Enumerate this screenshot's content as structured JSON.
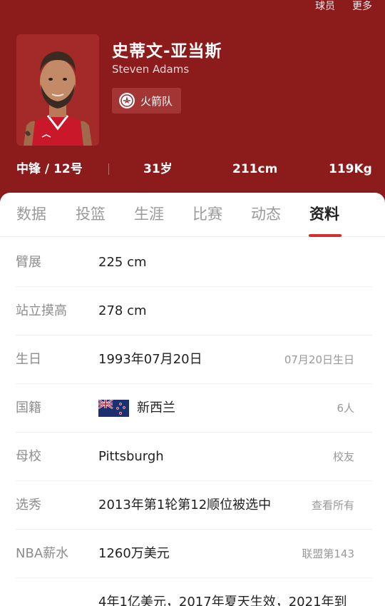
{
  "header": {
    "actions": [
      "球员",
      "更多"
    ],
    "background_color": "#8c1c1c"
  },
  "player": {
    "name_cn": "史蒂文-亚当斯",
    "name_en": "Steven Adams",
    "team": "火箭队",
    "position_number": "中锋 / 12号",
    "age": "31岁",
    "height": "211cm",
    "weight": "119Kg"
  },
  "tabs": {
    "items": [
      "数据",
      "投篮",
      "生涯",
      "比赛",
      "动态",
      "资料"
    ],
    "active": "资料",
    "accent_color": "#d0312d"
  },
  "profile": {
    "rows": [
      {
        "label": "臂展",
        "value": "225 cm",
        "extra": ""
      },
      {
        "label": "站立摸高",
        "value": "278 cm",
        "extra": ""
      },
      {
        "label": "生日",
        "value": "1993年07月20日",
        "extra": "07月20日生日"
      },
      {
        "label": "国籍",
        "value": "新西兰",
        "extra": "6人",
        "icon": "new-zealand-flag-icon"
      },
      {
        "label": "母校",
        "value": "Pittsburgh",
        "extra": "校友"
      },
      {
        "label": "选秀",
        "value": "2013年第1轮第12顺位被选中",
        "extra": "查看所有"
      },
      {
        "label": "NBA薪水",
        "value": "1260万美元",
        "extra": "联盟第143"
      },
      {
        "label": "",
        "value": "4年1亿美元，2017年夏天生效，2021年到",
        "extra": ""
      }
    ]
  }
}
